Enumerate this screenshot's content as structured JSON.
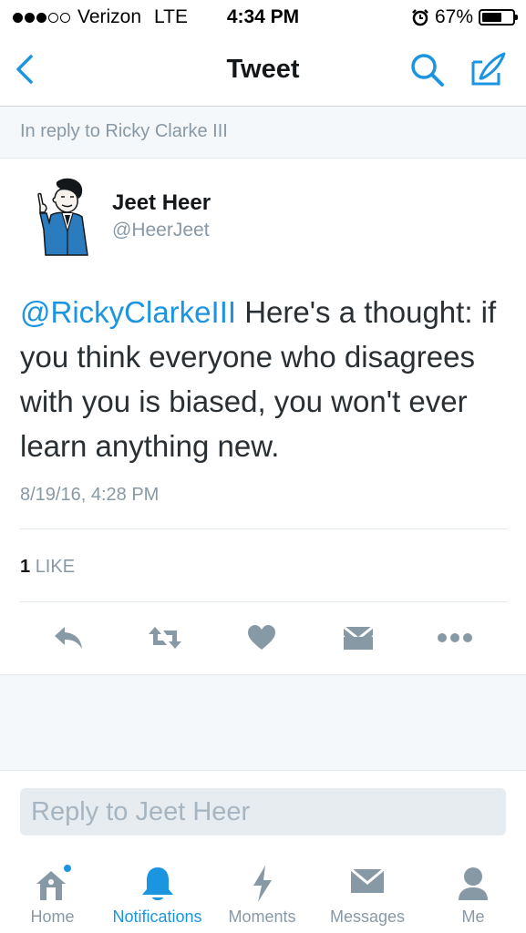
{
  "status_bar": {
    "carrier": "Verizon",
    "network": "LTE",
    "time": "4:34 PM",
    "battery": "67%",
    "battery_level": 0.67,
    "signal_bars_filled": 3,
    "signal_bars_total": 5
  },
  "nav": {
    "back_icon": "chevron-left-icon",
    "title": "Tweet",
    "search_icon": "search-icon",
    "compose_icon": "compose-tweet-icon"
  },
  "reply_context": "In reply to Ricky Clarke III",
  "tweet": {
    "author_name": "Jeet Heer",
    "author_handle": "@HeerJeet",
    "mention": "@RickyClarkeIII",
    "body": " Here's a thought: if you think everyone who disagrees with you is biased, you won't ever learn anything new.",
    "timestamp": "8/19/16, 4:28 PM",
    "like_count": "1",
    "like_label": "LIKE"
  },
  "actions": [
    {
      "name": "reply-icon"
    },
    {
      "name": "retweet-icon"
    },
    {
      "name": "heart-icon"
    },
    {
      "name": "direct-message-icon"
    },
    {
      "name": "more-icon"
    }
  ],
  "reply_input": {
    "placeholder": "Reply to Jeet Heer",
    "value": ""
  },
  "tabs": [
    {
      "label": "Home",
      "icon": "home-icon",
      "has_badge": true
    },
    {
      "label": "Notifications",
      "icon": "bell-icon",
      "active": true
    },
    {
      "label": "Moments",
      "icon": "lightning-icon"
    },
    {
      "label": "Messages",
      "icon": "envelope-icon"
    },
    {
      "label": "Me",
      "icon": "person-icon"
    }
  ],
  "colors": {
    "accent": "#1b95e0",
    "muted": "#8899a6",
    "icon_gray": "#8899a6",
    "background_gray": "#f5f8fa"
  }
}
